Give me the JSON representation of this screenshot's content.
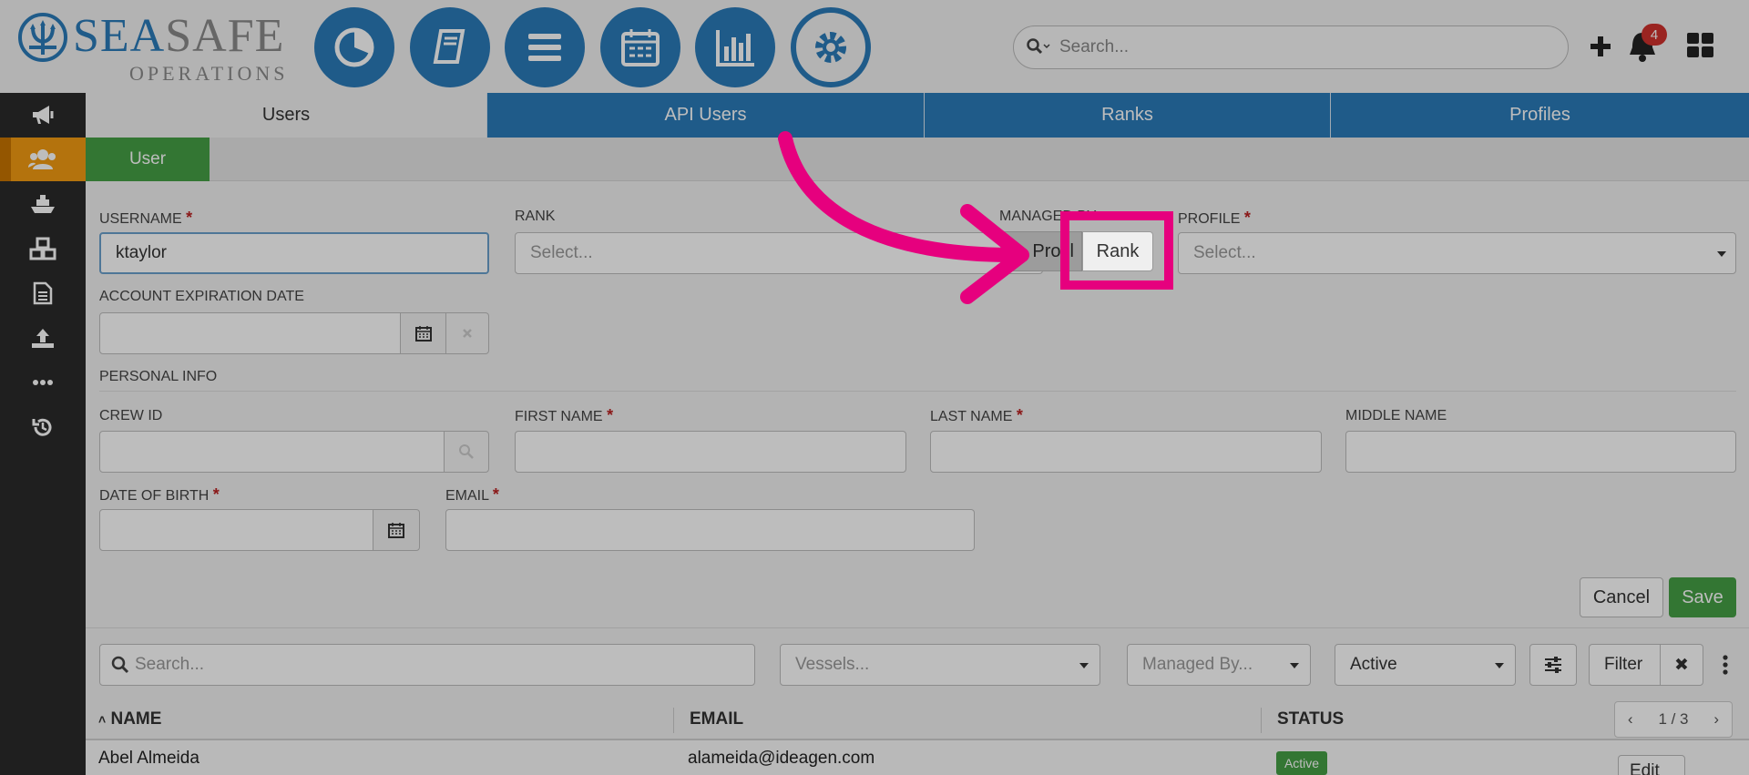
{
  "header": {
    "logo_text_sea": "SEA",
    "logo_text_safe": "SAFE",
    "logo_subtitle": "OPERATIONS",
    "nav_icons": [
      "pie-chart-icon",
      "book-icon",
      "list-icon",
      "calendar-icon",
      "bar-chart-icon",
      "gear-icon"
    ],
    "search_placeholder": "Search...",
    "notification_count": "4"
  },
  "sidebar": {
    "items": [
      "megaphone-icon",
      "users-icon",
      "ship-icon",
      "cubes-icon",
      "document-icon",
      "upload-icon",
      "more-icon",
      "history-icon"
    ],
    "active_index": 1
  },
  "tabs": [
    {
      "label": "Users",
      "active": true
    },
    {
      "label": "API Users",
      "active": false
    },
    {
      "label": "Ranks",
      "active": false
    },
    {
      "label": "Profiles",
      "active": false
    }
  ],
  "subtab": {
    "label": "User"
  },
  "form": {
    "username_label": "USERNAME",
    "username_value": "ktaylor",
    "rank_label": "RANK",
    "rank_placeholder": "Select...",
    "managed_by_label": "MANAGED BY",
    "managed_by_options": [
      "Profile",
      "Rank"
    ],
    "managed_by_visible_profile": "Profil",
    "managed_by_selected": "Rank",
    "profile_label": "PROFILE",
    "profile_placeholder": "Select...",
    "account_expiration_label": "ACCOUNT EXPIRATION DATE",
    "personal_info_label": "PERSONAL INFO",
    "crew_id_label": "CREW ID",
    "first_name_label": "FIRST NAME",
    "last_name_label": "LAST NAME",
    "middle_name_label": "MIDDLE NAME",
    "dob_label": "DATE OF BIRTH",
    "email_label": "EMAIL",
    "required_mark": "*",
    "cancel_label": "Cancel",
    "save_label": "Save"
  },
  "filters": {
    "search_placeholder": "Search...",
    "vessels_placeholder": "Vessels...",
    "managed_by_placeholder": "Managed By...",
    "status_value": "Active",
    "filter_label": "Filter",
    "clear_label": "✖"
  },
  "table": {
    "columns": [
      "NAME",
      "EMAIL",
      "STATUS"
    ],
    "sort_indicator": "˄",
    "pager": {
      "prev": "‹",
      "page": "1 / 3",
      "next": "›"
    },
    "rows": [
      {
        "name": "Abel Almeida",
        "email": "alameida@ideagen.com",
        "status": "Active",
        "action": "Edit"
      }
    ]
  },
  "colors": {
    "primary": "#2b7bb9",
    "success": "#46a046",
    "sidebar_active": "#f39c12",
    "highlight": "#e6007e",
    "badge": "#d0312d"
  }
}
